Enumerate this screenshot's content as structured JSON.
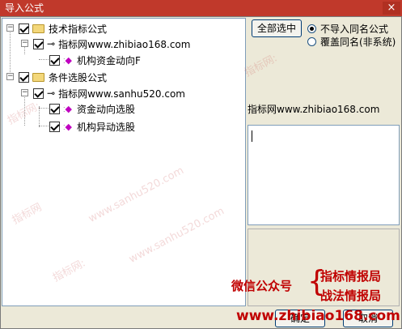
{
  "window": {
    "title": "导入公式",
    "close_glyph": "×"
  },
  "tree": {
    "nodes": [
      {
        "label": "技术指标公式"
      },
      {
        "label": "指标网www.zhibiao168.com"
      },
      {
        "label": "机构资金动向F"
      },
      {
        "label": "条件选股公式"
      },
      {
        "label": "指标网www.sanhu520.com"
      },
      {
        "label": "资金动向选股"
      },
      {
        "label": "机构异动选股"
      }
    ]
  },
  "right": {
    "select_all_label": "全部选中",
    "radio_no_import": "不导入同名公式",
    "radio_overwrite": "覆盖同名(非系统)",
    "info_text": "指标网www.zhibiao168.com"
  },
  "promo": {
    "wechat": "微信公众号",
    "brace": "{",
    "line1": "指标情报局",
    "line2": "战法情报局",
    "url": "www.zhibiao168.com"
  },
  "buttons": {
    "ok_label": "确定",
    "cancel_label": "取消"
  },
  "watermarks": [
    "www.sanhu520.com",
    "指标网:",
    "指标网",
    "指标网:",
    "www.sanhu520.com",
    "指标网:"
  ],
  "colors": {
    "titlebar": "#c0392b",
    "promo": "#c00000"
  }
}
